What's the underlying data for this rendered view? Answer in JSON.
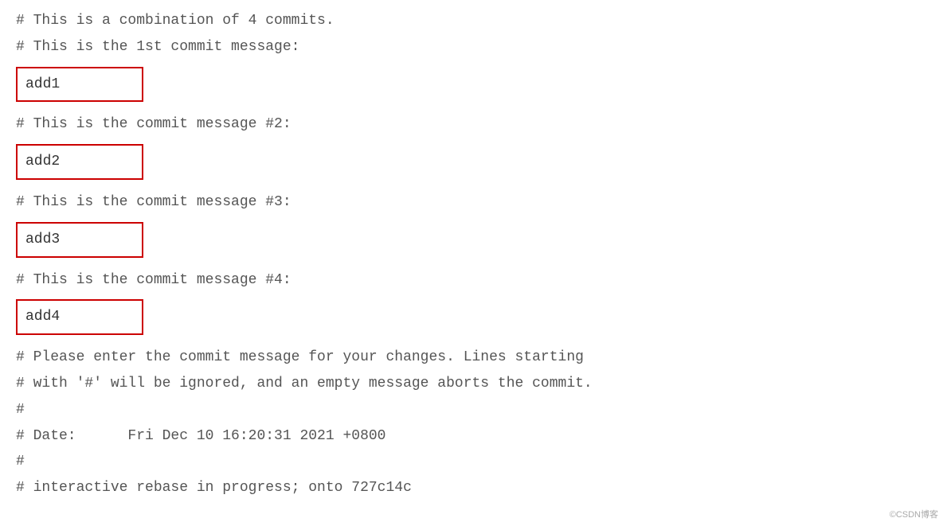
{
  "header": {
    "line1": "# This is a combination of 4 commits.",
    "line2": "# This is the 1st commit message:"
  },
  "commits": [
    {
      "id": "commit1",
      "label": "add1",
      "comment": "# This is the commit message #2:"
    },
    {
      "id": "commit2",
      "label": "add2",
      "comment": "# This is the commit message #3:"
    },
    {
      "id": "commit3",
      "label": "add3",
      "comment": "# This is the commit message #4:"
    },
    {
      "id": "commit4",
      "label": "add4",
      "comment": null
    }
  ],
  "footer": {
    "line1": "# Please enter the commit message for your changes. Lines starting",
    "line2": "# with '#' will be ignored, and an empty message aborts the commit.",
    "line3": "#",
    "line4": "# Date:      Fri Dec 10 16:20:31 2021 +0800",
    "line5": "#",
    "line6": "# interactive rebase in progress; onto 727c14c"
  },
  "watermark": "©CSDN博客"
}
